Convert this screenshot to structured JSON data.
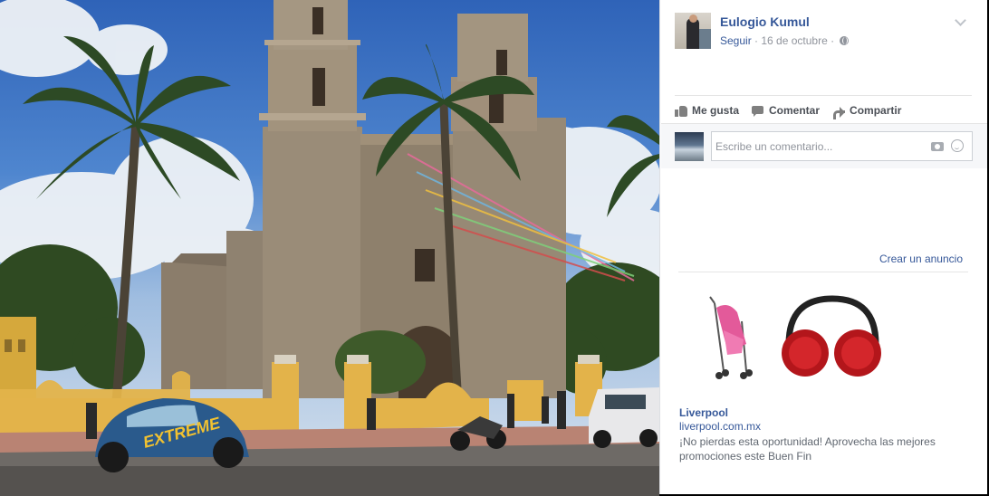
{
  "post": {
    "author": "Eulogio Kumul",
    "follow_label": "Seguir",
    "separator": " · ",
    "date": "16 de octubre",
    "separator2": " · "
  },
  "actions": {
    "like": "Me gusta",
    "comment": "Comentar",
    "share": "Compartir"
  },
  "comment_box": {
    "placeholder": "Escribe un comentario..."
  },
  "sidebar": {
    "create_ad": "Crear un anuncio"
  },
  "ad": {
    "title": "Liverpool",
    "url": "liverpool.com.mx",
    "description": "¡No pierdas esta oportunidad! Aprovecha las mejores promociones este Buen Fin"
  },
  "photo": {
    "car_text": "EXTREME"
  },
  "colors": {
    "link": "#365899",
    "meta": "#90949c",
    "wall": "#e3b34a"
  },
  "icons": [
    "chevron-down-icon",
    "globe-icon",
    "like-icon",
    "comment-icon",
    "share-icon",
    "camera-icon",
    "smiley-icon"
  ]
}
